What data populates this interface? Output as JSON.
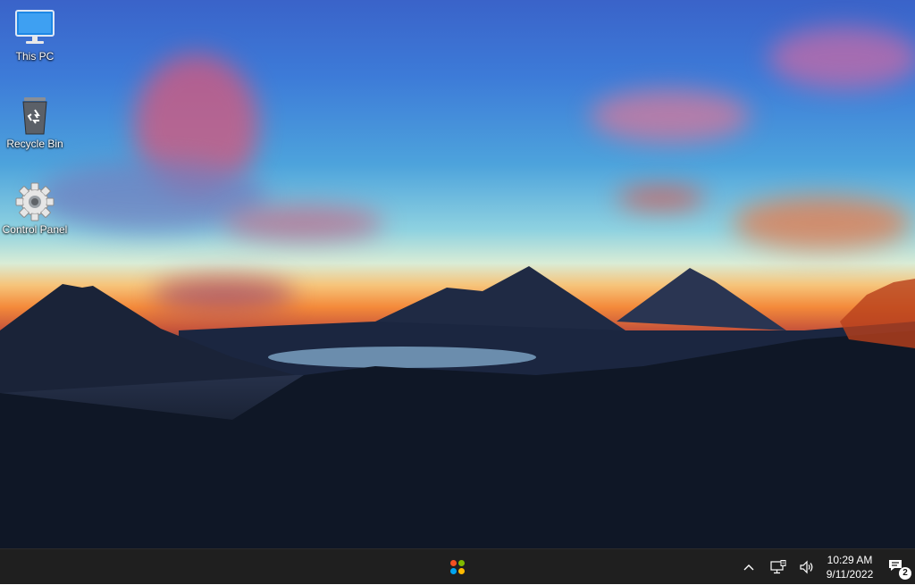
{
  "desktop": {
    "icons": [
      {
        "label": "This PC",
        "icon": "monitor-icon"
      },
      {
        "label": "Recycle Bin",
        "icon": "recycle-bin-icon"
      },
      {
        "label": "Control Panel",
        "icon": "gear-icon"
      }
    ]
  },
  "taskbar": {
    "start_icon": "start-dots-icon",
    "start_colors": [
      "#f25022",
      "#7fba00",
      "#00a4ef",
      "#ffb900"
    ],
    "tray": {
      "chevron_icon": "chevron-up-icon",
      "network_icon": "network-icon",
      "volume_icon": "speaker-icon"
    },
    "clock": {
      "time": "10:29 AM",
      "date": "9/11/2022"
    },
    "notifications": {
      "icon": "notification-icon",
      "count": "2"
    }
  }
}
